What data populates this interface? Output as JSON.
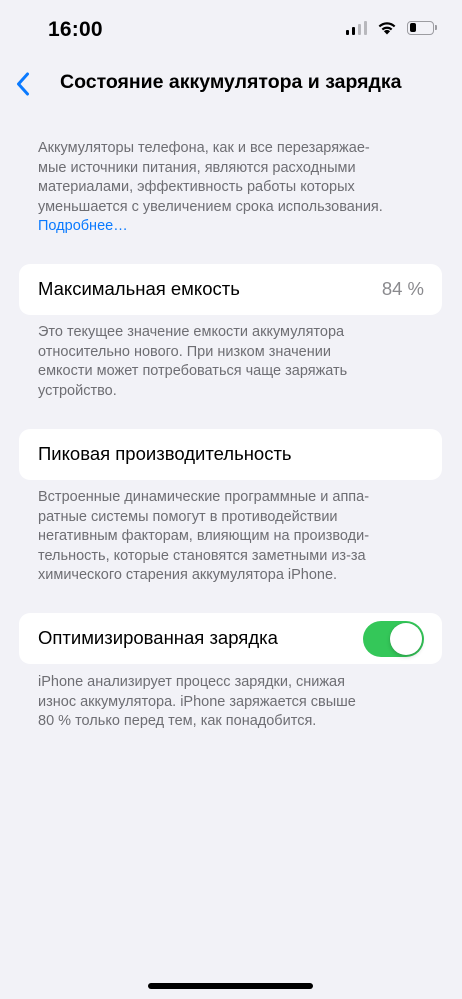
{
  "status_bar": {
    "time": "16:00",
    "signal_icon": "cellular-signal-icon",
    "wifi_icon": "wifi-icon",
    "battery_icon": "battery-icon",
    "battery_level": 0.3
  },
  "nav": {
    "back_icon": "chevron-left-icon",
    "title": "Состояние аккумулятора и зарядка"
  },
  "intro": {
    "lines": [
      "Аккумуляторы телефона, как и все перезаряжае-",
      "мые источники питания, являются расходными",
      "материалами, эффективность работы которых",
      "уменьшается с увеличением срока использования."
    ],
    "link": "Подробнее…"
  },
  "max_capacity": {
    "label": "Максимальная емкость",
    "value": "84 %",
    "footer_lines": [
      "Это текущее значение емкости аккумулятора",
      "относительно нового. При низком значении",
      "емкости может потребоваться чаще заряжать",
      "устройство."
    ]
  },
  "peak_performance": {
    "label": "Пиковая производительность",
    "footer_lines": [
      "Встроенные динамические программные и аппа-",
      "ратные системы помогут в противодействии",
      "негативным факторам, влияющим на производи-",
      "тельность, которые становятся заметными из-за",
      "химического старения аккумулятора iPhone."
    ]
  },
  "optimized_charging": {
    "label": "Оптимизированная зарядка",
    "enabled": true,
    "footer_lines": [
      "iPhone анализирует процесс зарядки, снижая",
      "износ аккумулятора. iPhone заряжается свыше",
      "80 % только перед тем, как понадобится."
    ]
  },
  "colors": {
    "background": "#f2f2f7",
    "link": "#0a7aff",
    "toggle_on": "#34c759",
    "secondary_text": "#6e6e73"
  }
}
